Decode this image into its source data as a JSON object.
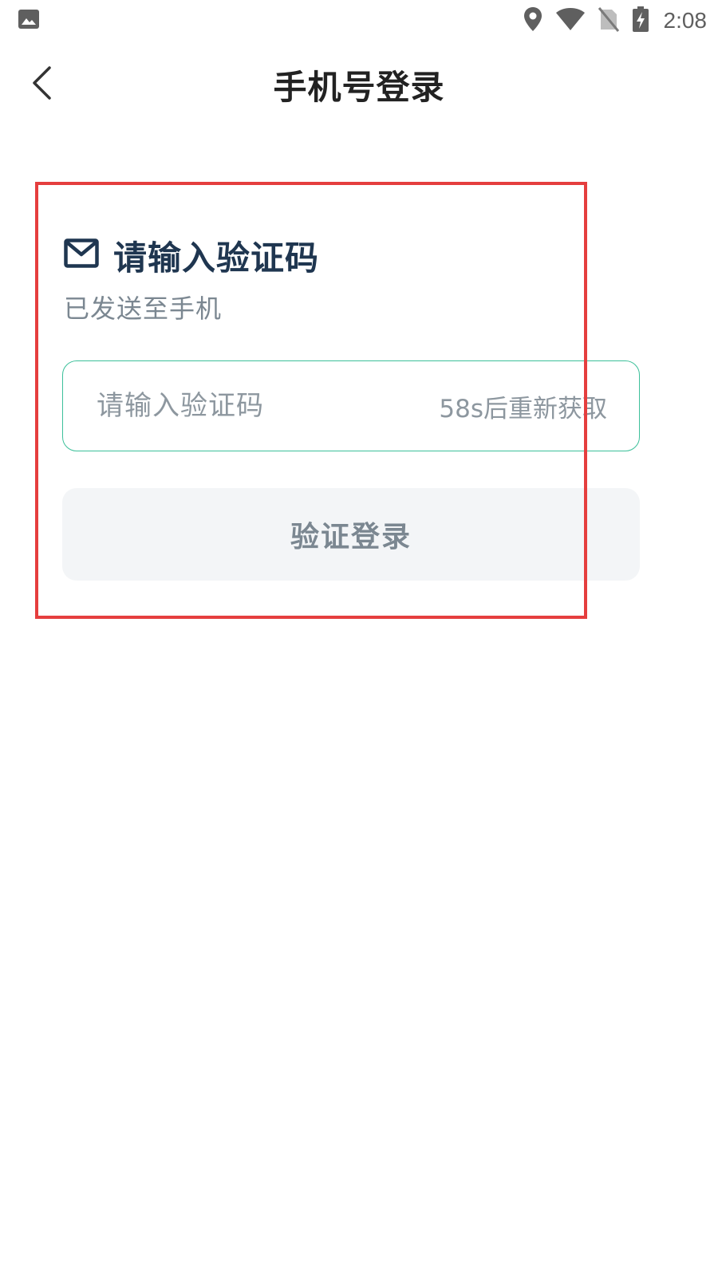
{
  "status_bar": {
    "time": "2:08",
    "icons": [
      "image-icon",
      "location-icon",
      "wifi-icon",
      "no-sim-icon",
      "battery-charging-icon"
    ]
  },
  "navbar": {
    "title": "手机号登录",
    "back_icon": "chevron-left-icon"
  },
  "verify": {
    "icon": "mail-icon",
    "title": "请输入验证码",
    "subtext": "已发送至手机",
    "input_placeholder": "请输入验证码",
    "input_value": "",
    "resend_label": "58s后重新获取",
    "submit_label": "验证登录"
  },
  "colors": {
    "accent_border": "#3cc09a",
    "heading": "#1f3650",
    "muted": "#7b8791",
    "button_bg": "#f3f5f7",
    "highlight": "#e53e3e"
  }
}
